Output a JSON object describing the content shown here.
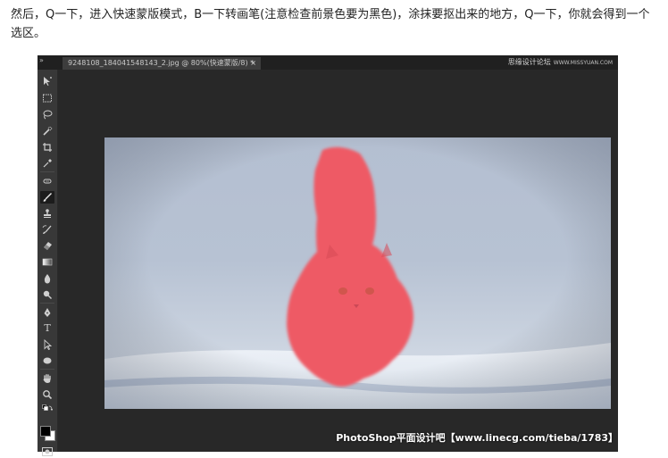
{
  "article": {
    "instruction": "然后，Q一下，进入快速蒙版模式，B一下转画笔(注意检查前景色要为黑色)，涂抹要抠出来的地方，Q一下，你就会得到一个选区。"
  },
  "photoshop": {
    "collapse_label": "»",
    "document_tab": {
      "title": "9248108_184041548143_2.jpg @ 80%(快速蒙版/8) *",
      "close_label": "×"
    },
    "site_watermark": {
      "name": "思缘设计论坛",
      "url": "WWW.MISSYUAN.COM"
    },
    "tools": [
      {
        "icon": "move-icon"
      },
      {
        "icon": "marquee-icon"
      },
      {
        "icon": "lasso-icon"
      },
      {
        "icon": "quick-selection-icon"
      },
      {
        "icon": "crop-icon"
      },
      {
        "icon": "eyedropper-icon"
      },
      {
        "icon": "healing-brush-icon"
      },
      {
        "icon": "brush-icon",
        "active": true
      },
      {
        "icon": "clone-stamp-icon"
      },
      {
        "icon": "history-brush-icon"
      },
      {
        "icon": "eraser-icon"
      },
      {
        "icon": "gradient-icon"
      },
      {
        "icon": "blur-icon"
      },
      {
        "icon": "dodge-icon"
      },
      {
        "icon": "pen-icon"
      },
      {
        "icon": "type-icon",
        "label": "T"
      },
      {
        "icon": "path-selection-icon"
      },
      {
        "icon": "ellipse-shape-icon"
      },
      {
        "icon": "hand-icon"
      },
      {
        "icon": "zoom-icon"
      }
    ],
    "colors": {
      "foreground": "#000000",
      "background": "#ffffff",
      "quick_mask_overlay": "#ee5a65"
    },
    "bottom_watermark": "PhotoShop平面设计吧【www.linecg.com/tieba/1783】"
  }
}
